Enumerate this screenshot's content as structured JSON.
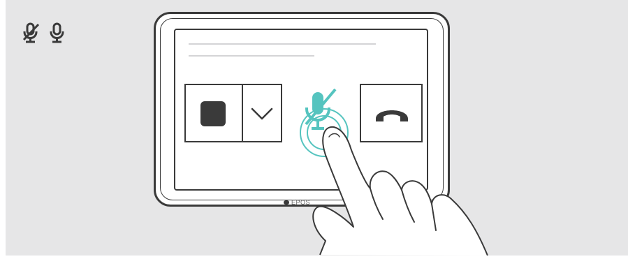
{
  "legend": {
    "muted_icon": "microphone-muted-icon",
    "unmuted_icon": "microphone-icon"
  },
  "device": {
    "brand": "EPOS"
  },
  "controls": {
    "share_button_icon": "stop-square-icon",
    "share_dropdown_icon": "chevron-down-icon",
    "mute_button_icon": "microphone-muted-icon",
    "mute_state": "touch-to-toggle",
    "hangup_button_icon": "phone-hangup-icon"
  },
  "colors": {
    "background": "#e6e6e7",
    "outline": "#3a3a3a",
    "accent": "#55c4bf",
    "line": "#d4d4d6"
  }
}
